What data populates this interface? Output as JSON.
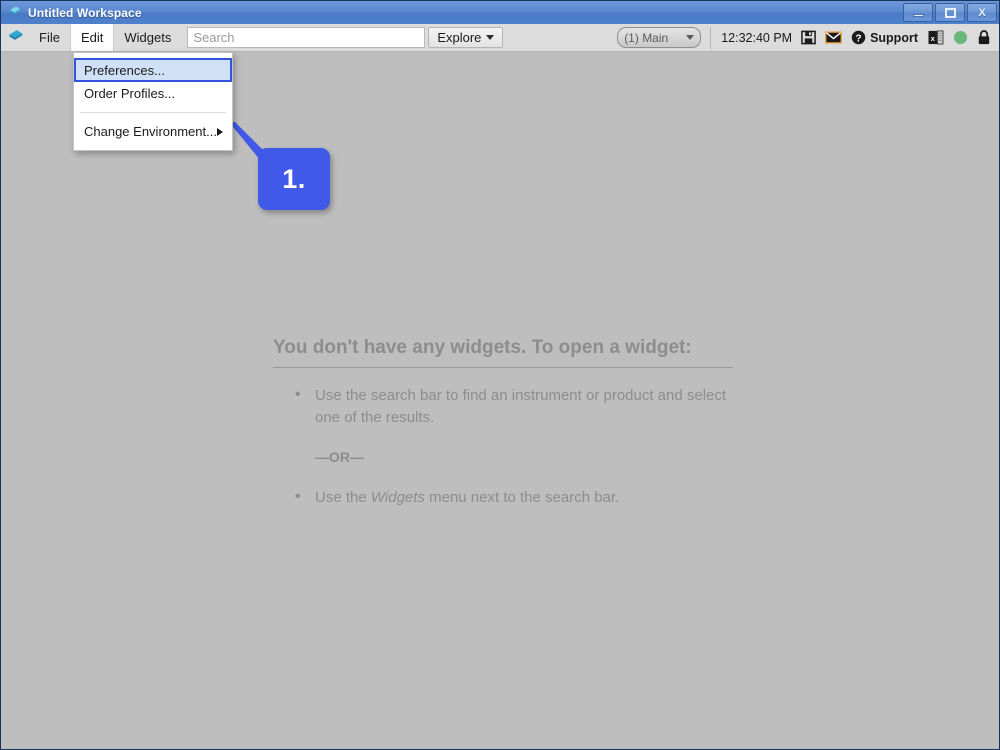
{
  "window": {
    "title": "Untitled Workspace",
    "app_icon": "diamond-logo-icon",
    "controls": {
      "minimize": "minimize-icon",
      "maximize": "maximize-icon",
      "close": "X"
    }
  },
  "toolbar": {
    "menus": [
      {
        "label": "File",
        "active": false
      },
      {
        "label": "Edit",
        "active": true
      },
      {
        "label": "Widgets",
        "active": false
      }
    ],
    "search": {
      "value": "",
      "placeholder": "Search"
    },
    "explore_label": "Explore",
    "profile_select": {
      "value": "(1) Main"
    },
    "clock": "12:32:40 PM",
    "icons": [
      "save-icon",
      "mail-icon",
      "help-circle-icon",
      "excel-icon",
      "status-green-icon",
      "lock-icon"
    ],
    "support_label": "Support"
  },
  "menu_dropdown": {
    "items": [
      {
        "label": "Preferences...",
        "highlighted": true,
        "submenu": false
      },
      {
        "label": "Order Profiles...",
        "highlighted": false,
        "submenu": false
      },
      {
        "label": "Change Environment...",
        "highlighted": false,
        "submenu": true
      }
    ]
  },
  "callout": {
    "number": "1."
  },
  "empty_state": {
    "title": "You don't have any widgets. To open a widget:",
    "bullet_one": "Use the search bar to find an instrument or product and select one of the results.",
    "or_text": "—OR—",
    "bullet_two_prefix": "Use the ",
    "bullet_two_emphasis": "Widgets",
    "bullet_two_suffix": " menu next to the search bar."
  },
  "colors": {
    "titlebar_blue": "#5b88d0",
    "window_frame": "#3a6cb5",
    "toolbar_gray": "#dcdcdc",
    "content_gray": "#bebebe",
    "callout_blue": "#4059e8",
    "highlight_fill": "#cfe0f7",
    "highlight_border": "#3355dd",
    "status_green": "#6ab77a"
  }
}
